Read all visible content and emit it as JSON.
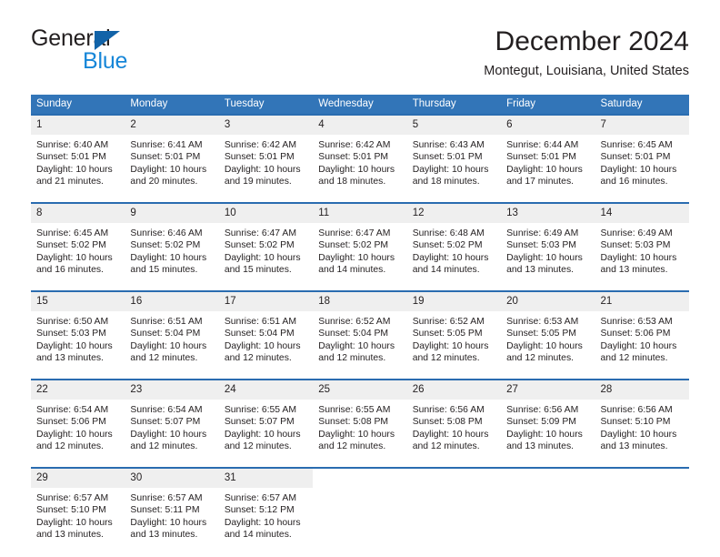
{
  "brand": {
    "name_part1": "General",
    "name_part2": "Blue",
    "triangle_color": "#1263a8",
    "blue_text_color": "#1686d8"
  },
  "header": {
    "month_title": "December 2024",
    "location": "Montegut, Louisiana, United States"
  },
  "theme": {
    "header_blue": "#3275b8",
    "row_border_blue": "#2a6cb0",
    "daynum_background": "#efefef",
    "text_color": "#231f20"
  },
  "weekday_headers": [
    "Sunday",
    "Monday",
    "Tuesday",
    "Wednesday",
    "Thursday",
    "Friday",
    "Saturday"
  ],
  "weeks": [
    [
      {
        "day": "1",
        "sunrise": "Sunrise: 6:40 AM",
        "sunset": "Sunset: 5:01 PM",
        "daylight_line1": "Daylight: 10 hours",
        "daylight_line2": "and 21 minutes."
      },
      {
        "day": "2",
        "sunrise": "Sunrise: 6:41 AM",
        "sunset": "Sunset: 5:01 PM",
        "daylight_line1": "Daylight: 10 hours",
        "daylight_line2": "and 20 minutes."
      },
      {
        "day": "3",
        "sunrise": "Sunrise: 6:42 AM",
        "sunset": "Sunset: 5:01 PM",
        "daylight_line1": "Daylight: 10 hours",
        "daylight_line2": "and 19 minutes."
      },
      {
        "day": "4",
        "sunrise": "Sunrise: 6:42 AM",
        "sunset": "Sunset: 5:01 PM",
        "daylight_line1": "Daylight: 10 hours",
        "daylight_line2": "and 18 minutes."
      },
      {
        "day": "5",
        "sunrise": "Sunrise: 6:43 AM",
        "sunset": "Sunset: 5:01 PM",
        "daylight_line1": "Daylight: 10 hours",
        "daylight_line2": "and 18 minutes."
      },
      {
        "day": "6",
        "sunrise": "Sunrise: 6:44 AM",
        "sunset": "Sunset: 5:01 PM",
        "daylight_line1": "Daylight: 10 hours",
        "daylight_line2": "and 17 minutes."
      },
      {
        "day": "7",
        "sunrise": "Sunrise: 6:45 AM",
        "sunset": "Sunset: 5:01 PM",
        "daylight_line1": "Daylight: 10 hours",
        "daylight_line2": "and 16 minutes."
      }
    ],
    [
      {
        "day": "8",
        "sunrise": "Sunrise: 6:45 AM",
        "sunset": "Sunset: 5:02 PM",
        "daylight_line1": "Daylight: 10 hours",
        "daylight_line2": "and 16 minutes."
      },
      {
        "day": "9",
        "sunrise": "Sunrise: 6:46 AM",
        "sunset": "Sunset: 5:02 PM",
        "daylight_line1": "Daylight: 10 hours",
        "daylight_line2": "and 15 minutes."
      },
      {
        "day": "10",
        "sunrise": "Sunrise: 6:47 AM",
        "sunset": "Sunset: 5:02 PM",
        "daylight_line1": "Daylight: 10 hours",
        "daylight_line2": "and 15 minutes."
      },
      {
        "day": "11",
        "sunrise": "Sunrise: 6:47 AM",
        "sunset": "Sunset: 5:02 PM",
        "daylight_line1": "Daylight: 10 hours",
        "daylight_line2": "and 14 minutes."
      },
      {
        "day": "12",
        "sunrise": "Sunrise: 6:48 AM",
        "sunset": "Sunset: 5:02 PM",
        "daylight_line1": "Daylight: 10 hours",
        "daylight_line2": "and 14 minutes."
      },
      {
        "day": "13",
        "sunrise": "Sunrise: 6:49 AM",
        "sunset": "Sunset: 5:03 PM",
        "daylight_line1": "Daylight: 10 hours",
        "daylight_line2": "and 13 minutes."
      },
      {
        "day": "14",
        "sunrise": "Sunrise: 6:49 AM",
        "sunset": "Sunset: 5:03 PM",
        "daylight_line1": "Daylight: 10 hours",
        "daylight_line2": "and 13 minutes."
      }
    ],
    [
      {
        "day": "15",
        "sunrise": "Sunrise: 6:50 AM",
        "sunset": "Sunset: 5:03 PM",
        "daylight_line1": "Daylight: 10 hours",
        "daylight_line2": "and 13 minutes."
      },
      {
        "day": "16",
        "sunrise": "Sunrise: 6:51 AM",
        "sunset": "Sunset: 5:04 PM",
        "daylight_line1": "Daylight: 10 hours",
        "daylight_line2": "and 12 minutes."
      },
      {
        "day": "17",
        "sunrise": "Sunrise: 6:51 AM",
        "sunset": "Sunset: 5:04 PM",
        "daylight_line1": "Daylight: 10 hours",
        "daylight_line2": "and 12 minutes."
      },
      {
        "day": "18",
        "sunrise": "Sunrise: 6:52 AM",
        "sunset": "Sunset: 5:04 PM",
        "daylight_line1": "Daylight: 10 hours",
        "daylight_line2": "and 12 minutes."
      },
      {
        "day": "19",
        "sunrise": "Sunrise: 6:52 AM",
        "sunset": "Sunset: 5:05 PM",
        "daylight_line1": "Daylight: 10 hours",
        "daylight_line2": "and 12 minutes."
      },
      {
        "day": "20",
        "sunrise": "Sunrise: 6:53 AM",
        "sunset": "Sunset: 5:05 PM",
        "daylight_line1": "Daylight: 10 hours",
        "daylight_line2": "and 12 minutes."
      },
      {
        "day": "21",
        "sunrise": "Sunrise: 6:53 AM",
        "sunset": "Sunset: 5:06 PM",
        "daylight_line1": "Daylight: 10 hours",
        "daylight_line2": "and 12 minutes."
      }
    ],
    [
      {
        "day": "22",
        "sunrise": "Sunrise: 6:54 AM",
        "sunset": "Sunset: 5:06 PM",
        "daylight_line1": "Daylight: 10 hours",
        "daylight_line2": "and 12 minutes."
      },
      {
        "day": "23",
        "sunrise": "Sunrise: 6:54 AM",
        "sunset": "Sunset: 5:07 PM",
        "daylight_line1": "Daylight: 10 hours",
        "daylight_line2": "and 12 minutes."
      },
      {
        "day": "24",
        "sunrise": "Sunrise: 6:55 AM",
        "sunset": "Sunset: 5:07 PM",
        "daylight_line1": "Daylight: 10 hours",
        "daylight_line2": "and 12 minutes."
      },
      {
        "day": "25",
        "sunrise": "Sunrise: 6:55 AM",
        "sunset": "Sunset: 5:08 PM",
        "daylight_line1": "Daylight: 10 hours",
        "daylight_line2": "and 12 minutes."
      },
      {
        "day": "26",
        "sunrise": "Sunrise: 6:56 AM",
        "sunset": "Sunset: 5:08 PM",
        "daylight_line1": "Daylight: 10 hours",
        "daylight_line2": "and 12 minutes."
      },
      {
        "day": "27",
        "sunrise": "Sunrise: 6:56 AM",
        "sunset": "Sunset: 5:09 PM",
        "daylight_line1": "Daylight: 10 hours",
        "daylight_line2": "and 13 minutes."
      },
      {
        "day": "28",
        "sunrise": "Sunrise: 6:56 AM",
        "sunset": "Sunset: 5:10 PM",
        "daylight_line1": "Daylight: 10 hours",
        "daylight_line2": "and 13 minutes."
      }
    ],
    [
      {
        "day": "29",
        "sunrise": "Sunrise: 6:57 AM",
        "sunset": "Sunset: 5:10 PM",
        "daylight_line1": "Daylight: 10 hours",
        "daylight_line2": "and 13 minutes."
      },
      {
        "day": "30",
        "sunrise": "Sunrise: 6:57 AM",
        "sunset": "Sunset: 5:11 PM",
        "daylight_line1": "Daylight: 10 hours",
        "daylight_line2": "and 13 minutes."
      },
      {
        "day": "31",
        "sunrise": "Sunrise: 6:57 AM",
        "sunset": "Sunset: 5:12 PM",
        "daylight_line1": "Daylight: 10 hours",
        "daylight_line2": "and 14 minutes."
      },
      {
        "day": "",
        "sunrise": "",
        "sunset": "",
        "daylight_line1": "",
        "daylight_line2": ""
      },
      {
        "day": "",
        "sunrise": "",
        "sunset": "",
        "daylight_line1": "",
        "daylight_line2": ""
      },
      {
        "day": "",
        "sunrise": "",
        "sunset": "",
        "daylight_line1": "",
        "daylight_line2": ""
      },
      {
        "day": "",
        "sunrise": "",
        "sunset": "",
        "daylight_line1": "",
        "daylight_line2": ""
      }
    ]
  ]
}
